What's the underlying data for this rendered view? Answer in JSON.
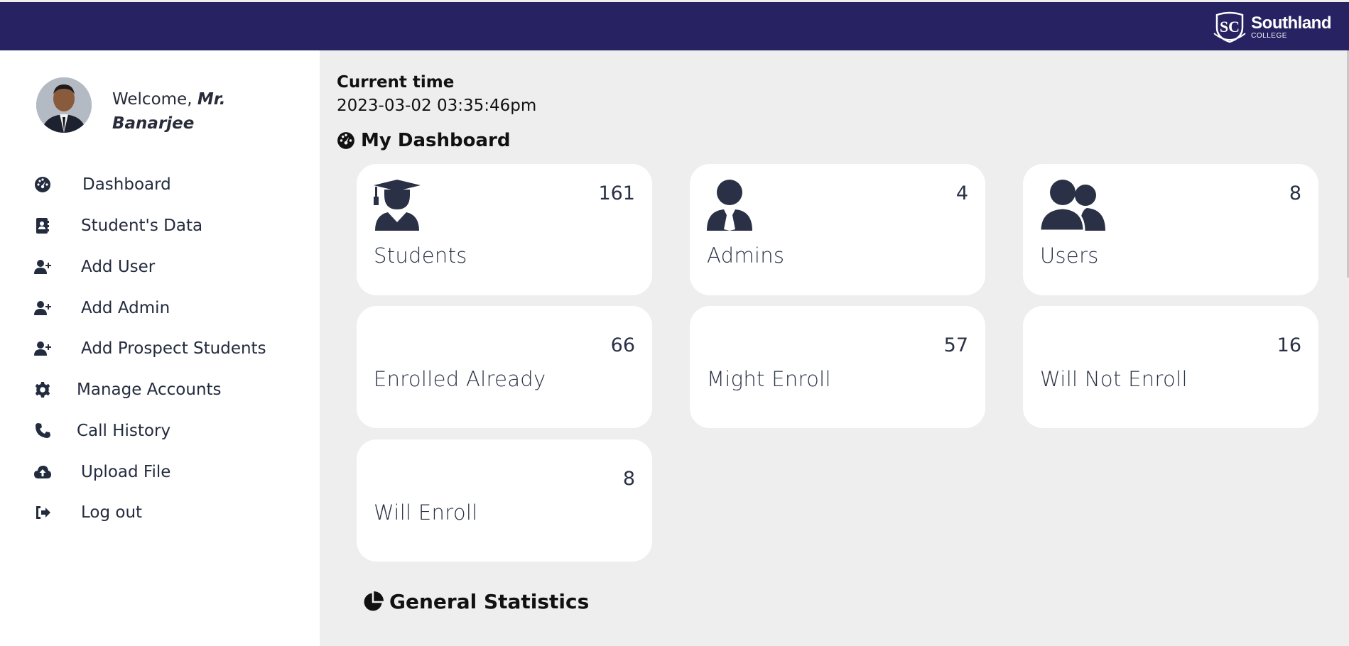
{
  "brand": {
    "name": "Southland",
    "sub": "COLLEGE",
    "primary_color": "#272262"
  },
  "user": {
    "greeting": "Welcome,",
    "title": "Mr.",
    "name": "Banarjee"
  },
  "nav": [
    {
      "label": "Dashboard",
      "icon": "gauge-icon"
    },
    {
      "label": "Student's Data",
      "icon": "address-book-icon"
    },
    {
      "label": "Add User",
      "icon": "user-plus-icon"
    },
    {
      "label": "Add Admin",
      "icon": "user-plus-icon"
    },
    {
      "label": "Add Prospect Students",
      "icon": "user-plus-icon"
    },
    {
      "label": "Manage Accounts",
      "icon": "gear-icon"
    },
    {
      "label": "Call History",
      "icon": "phone-icon"
    },
    {
      "label": "Upload File",
      "icon": "cloud-upload-icon"
    },
    {
      "label": "Log out",
      "icon": "logout-icon"
    }
  ],
  "time": {
    "title": "Current time",
    "value": "2023-03-02 03:35:46pm"
  },
  "dashboard": {
    "title": "My Dashboard"
  },
  "cards": [
    {
      "label": "Students",
      "count": "161",
      "icon": "graduate-icon"
    },
    {
      "label": "Admins",
      "count": "4",
      "icon": "user-tie-icon"
    },
    {
      "label": "Users",
      "count": "8",
      "icon": "users-icon"
    },
    {
      "label": "Enrolled Already",
      "count": "66"
    },
    {
      "label": "Might Enroll",
      "count": "57"
    },
    {
      "label": "Will Not Enroll",
      "count": "16"
    },
    {
      "label": "Will Enroll",
      "count": "8"
    }
  ],
  "stats": {
    "title": "General Statistics"
  }
}
